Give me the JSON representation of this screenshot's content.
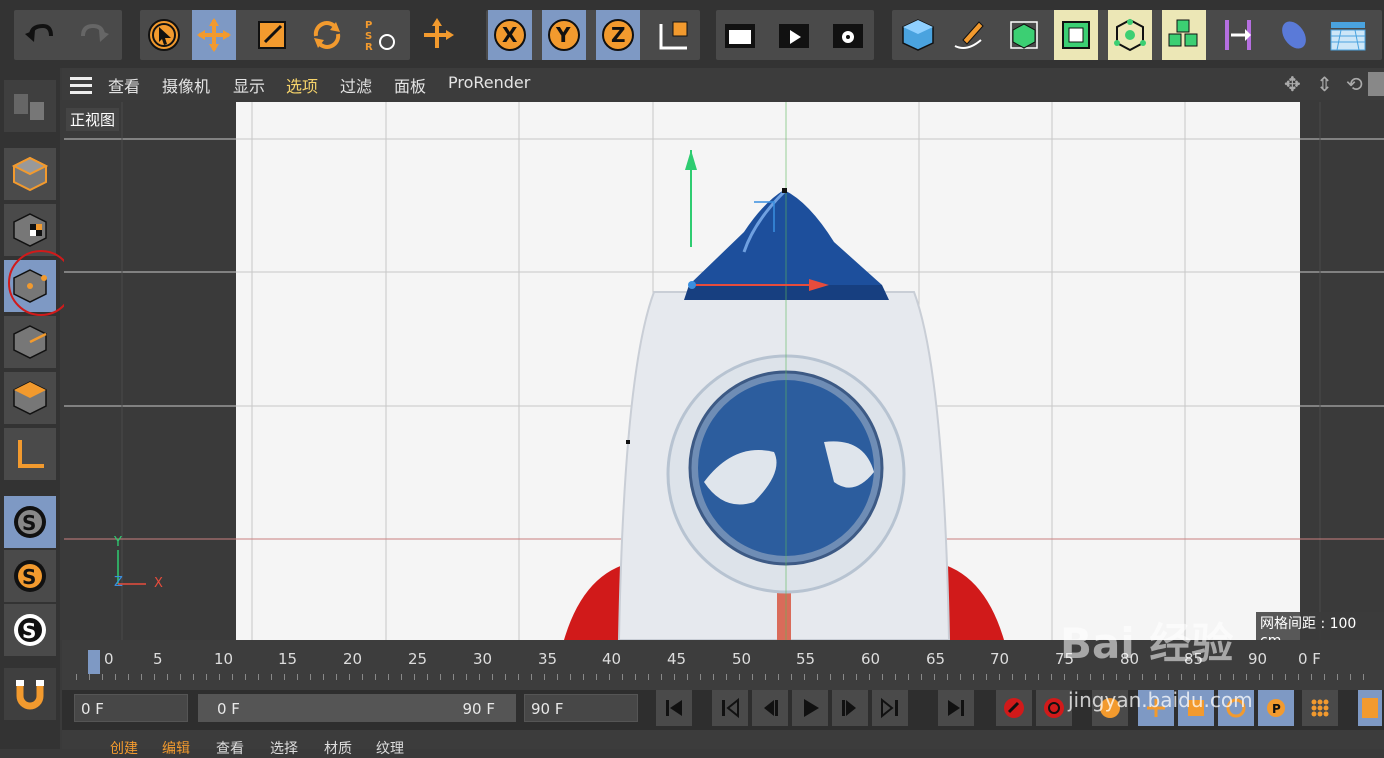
{
  "menu": {
    "items": [
      "查看",
      "摄像机",
      "显示",
      "选项",
      "过滤",
      "面板",
      "ProRender"
    ]
  },
  "viewport": {
    "label": "正视图",
    "axis_x": "X",
    "axis_y": "Y",
    "axis_z": "Z",
    "grid_spacing": "网格间距 : 100 cm"
  },
  "timeline": {
    "ticks": [
      "0",
      "5",
      "10",
      "15",
      "20",
      "25",
      "30",
      "35",
      "40",
      "45",
      "50",
      "55",
      "60",
      "65",
      "70",
      "75",
      "80",
      "85",
      "90"
    ],
    "end_label": "0 F"
  },
  "transport": {
    "current_frame": "0 F",
    "range_start": "0 F",
    "range_end": "90 F",
    "max_frame": "90 F"
  },
  "bottom_menu": [
    "创建",
    "编辑",
    "查看",
    "选择",
    "材质",
    "纹理"
  ],
  "watermark": {
    "brand": "Bai 经验",
    "url": "jingyan.baidu.com"
  },
  "colors": {
    "accent_select": "#7e99c4",
    "highlight": "#ece7b6",
    "orange": "#f29a2e",
    "rocket_blue": "#1d4f9c",
    "rocket_red": "#d11a1a"
  }
}
